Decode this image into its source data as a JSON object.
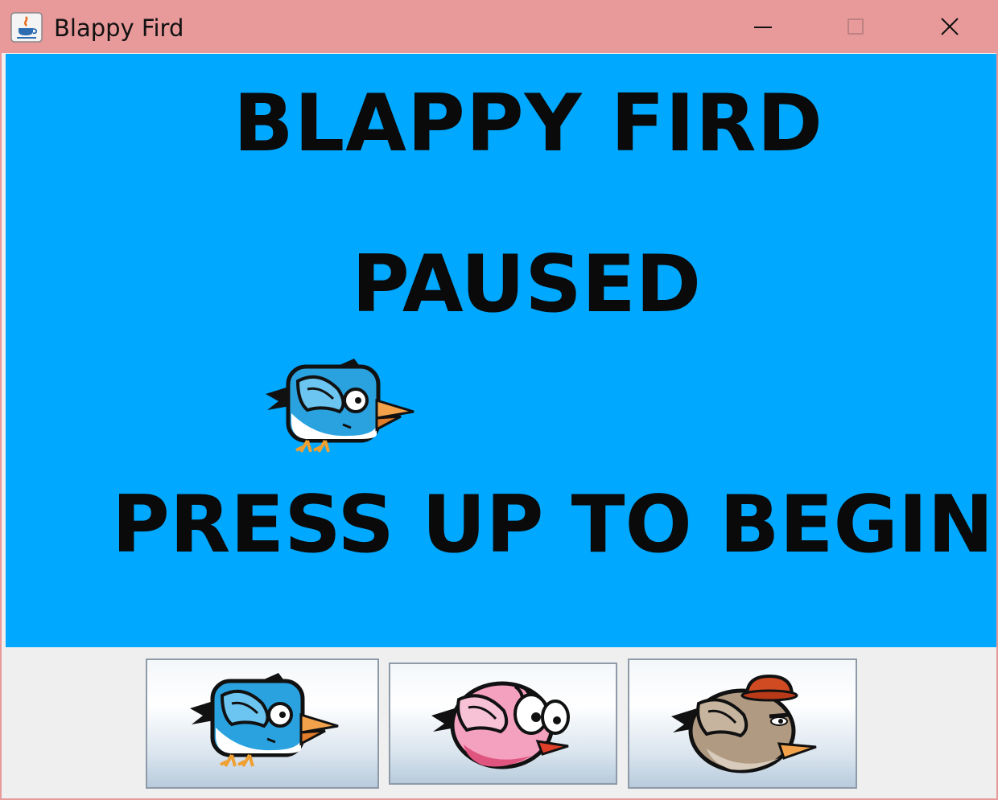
{
  "window": {
    "title": "Blappy Fird",
    "icon": "java-cup-icon",
    "controls": [
      "minimize-icon",
      "maximize-icon",
      "close-icon"
    ]
  },
  "game": {
    "title": "BLAPPY FIRD",
    "status": "PAUSED",
    "prompt": "PRESS UP TO BEGIN",
    "player_character": "blue-bird",
    "background_color": "#00a8ff"
  },
  "character_buttons": [
    {
      "character": "blue-bird",
      "icon": "blue-bird-icon"
    },
    {
      "character": "pink-bird",
      "icon": "pink-bird-icon"
    },
    {
      "character": "brown-bird",
      "icon": "brown-bird-with-hat-icon"
    }
  ],
  "colors": {
    "titlebar": "#e8999a",
    "sky": "#00a8ff",
    "panel": "#efefef",
    "text": "#0a0a0a"
  }
}
